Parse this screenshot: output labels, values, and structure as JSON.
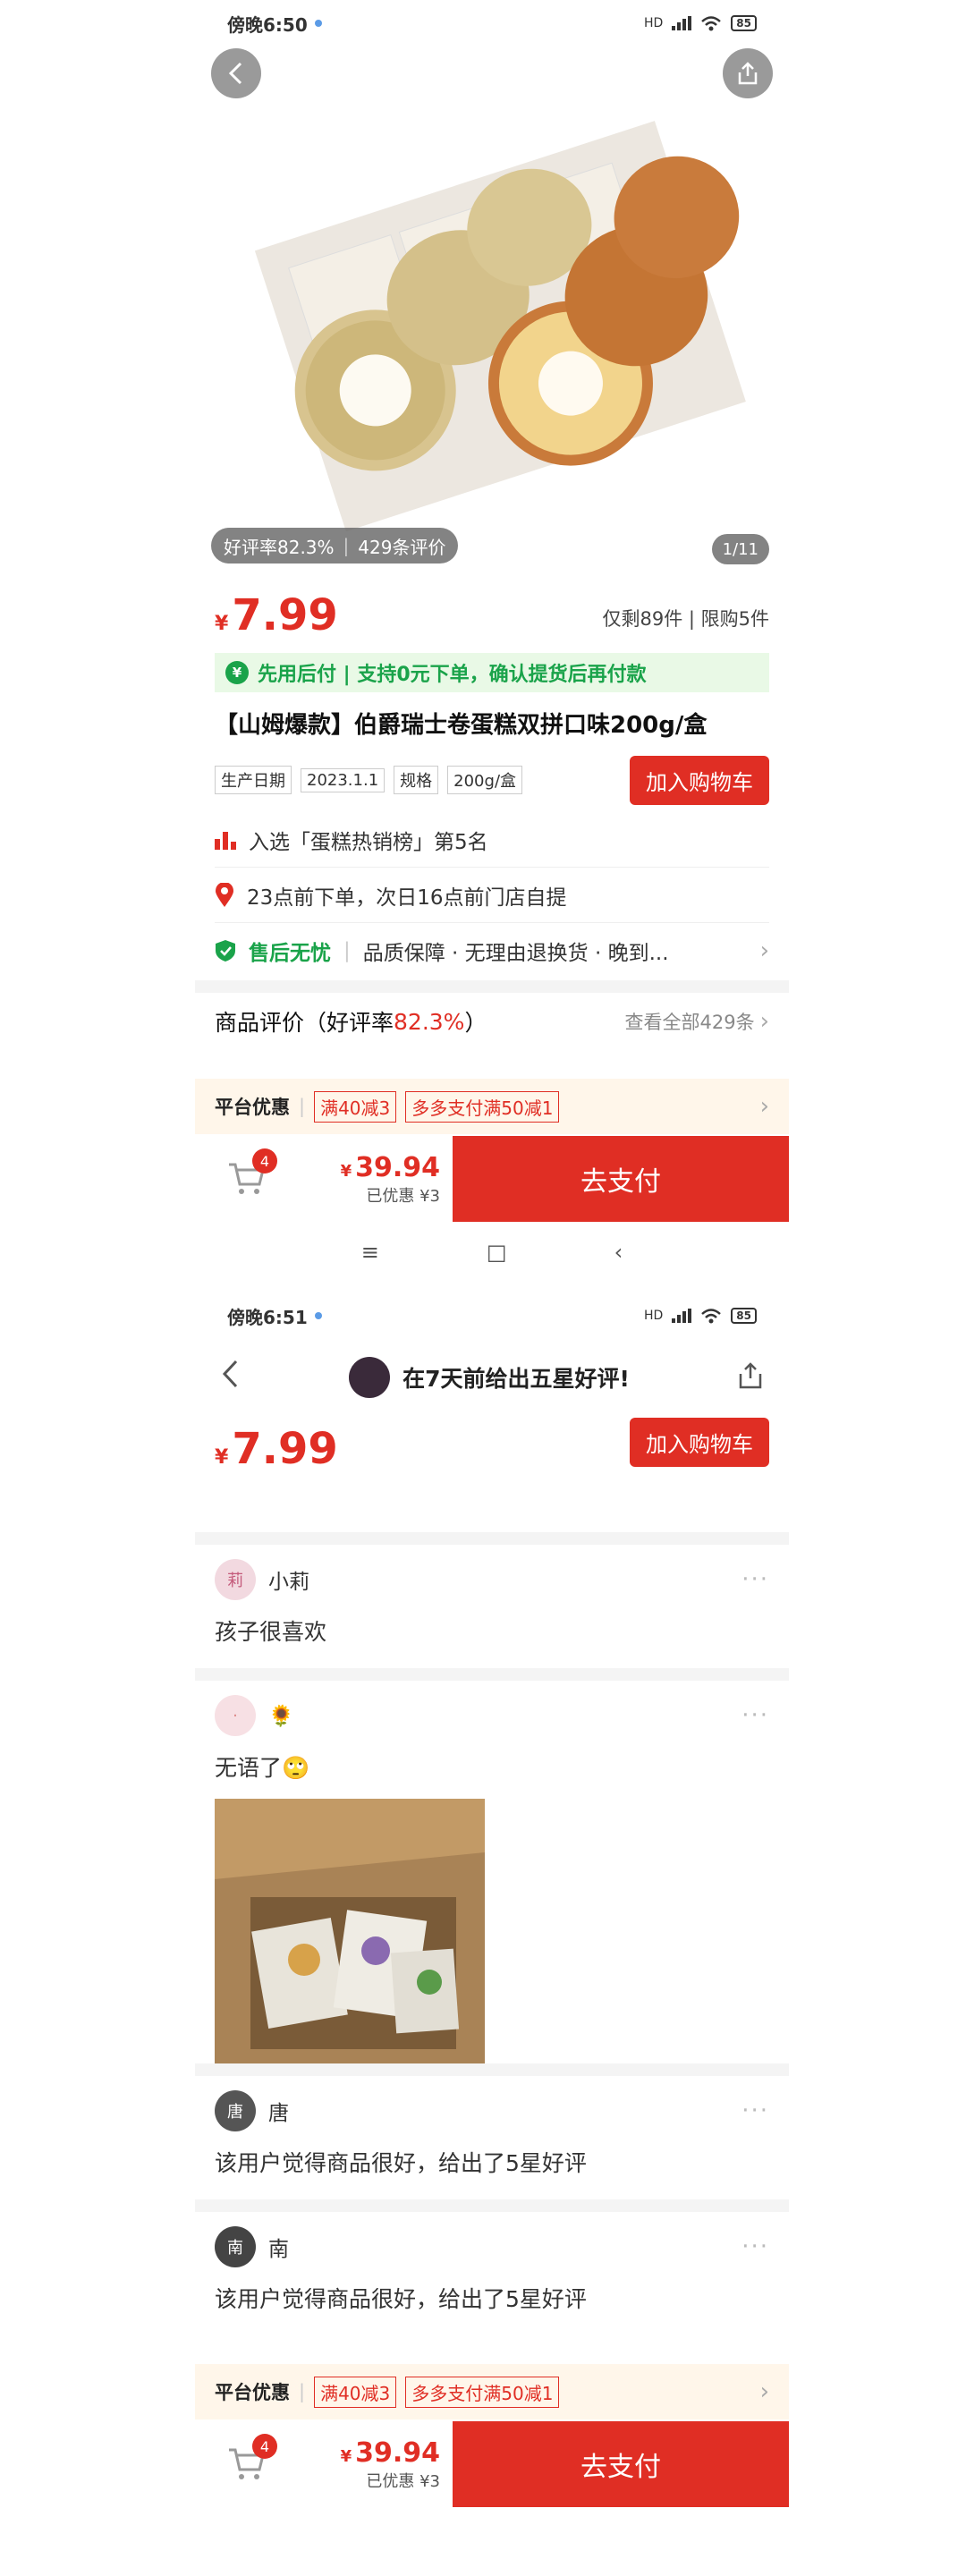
{
  "colors": {
    "accent": "#e02e24",
    "green": "#1aa34a",
    "promo_bg": "#e9f9e6",
    "platform_bg": "#fff6ea"
  },
  "screen1": {
    "status": {
      "time": "傍晚6:50",
      "signal": "HD",
      "battery": "85"
    },
    "icons": {
      "back": "back-arrow-icon",
      "share": "share-icon"
    },
    "hero": {
      "rating": "好评率82.3%",
      "reviews": "429条评价",
      "page": "1/11"
    },
    "price": {
      "yen": "¥",
      "value": "7.99",
      "stock": "仅剩89件 | 限购5件"
    },
    "promo": {
      "icon": "¥",
      "text": "先用后付 | 支持0元下单，确认提货后再付款"
    },
    "title": "【山姆爆款】伯爵瑞士卷蛋糕双拼口味200g/盒",
    "specs": {
      "date_label": "生产日期",
      "date_value": "2023.1.1",
      "spec_label": "规格",
      "spec_value": "200g/盒",
      "cart_button": "加入购物车"
    },
    "rank": "入选「蛋糕热销榜」第5名",
    "delivery": "23点前下单，次日16点前门店自提",
    "service": {
      "title": "售后无忧",
      "items": "品质保障 · 无理由退换货 · 晚到..."
    },
    "reviews_head": {
      "prefix": "商品评价（好评率",
      "rate": "82.3%",
      "suffix": "）",
      "all": "查看全部429条"
    },
    "platform": {
      "label": "平台优惠",
      "coupon1": "满40减3",
      "coupon2": "多多支付满50减1"
    },
    "bottom": {
      "cart_count": "4",
      "total_yen": "¥",
      "total": "39.94",
      "saved": "已优惠 ¥3",
      "pay": "去支付"
    },
    "nav": {
      "menu": "≡",
      "home": "□",
      "back": "‹"
    }
  },
  "screen2": {
    "status": {
      "time": "傍晚6:51",
      "signal": "HD",
      "battery": "85"
    },
    "topnav": {
      "text": "在7天前给出五星好评!"
    },
    "price": {
      "yen": "¥",
      "value": "7.99",
      "cart_button": "加入购物车"
    },
    "reviews": [
      {
        "name": "小莉",
        "text": "孩子很喜欢",
        "avatar": "莉"
      },
      {
        "name": "🌻",
        "text": "无语了🙄",
        "avatar": "·"
      },
      {
        "name": "唐",
        "text": "该用户觉得商品很好，给出了5星好评",
        "avatar": "唐"
      },
      {
        "name": "南",
        "text": "该用户觉得商品很好，给出了5星好评",
        "avatar": "南"
      }
    ],
    "platform": {
      "label": "平台优惠",
      "coupon1": "满40减3",
      "coupon2": "多多支付满50减1"
    },
    "bottom": {
      "cart_count": "4",
      "total_yen": "¥",
      "total": "39.94",
      "saved": "已优惠 ¥3",
      "pay": "去支付"
    }
  }
}
